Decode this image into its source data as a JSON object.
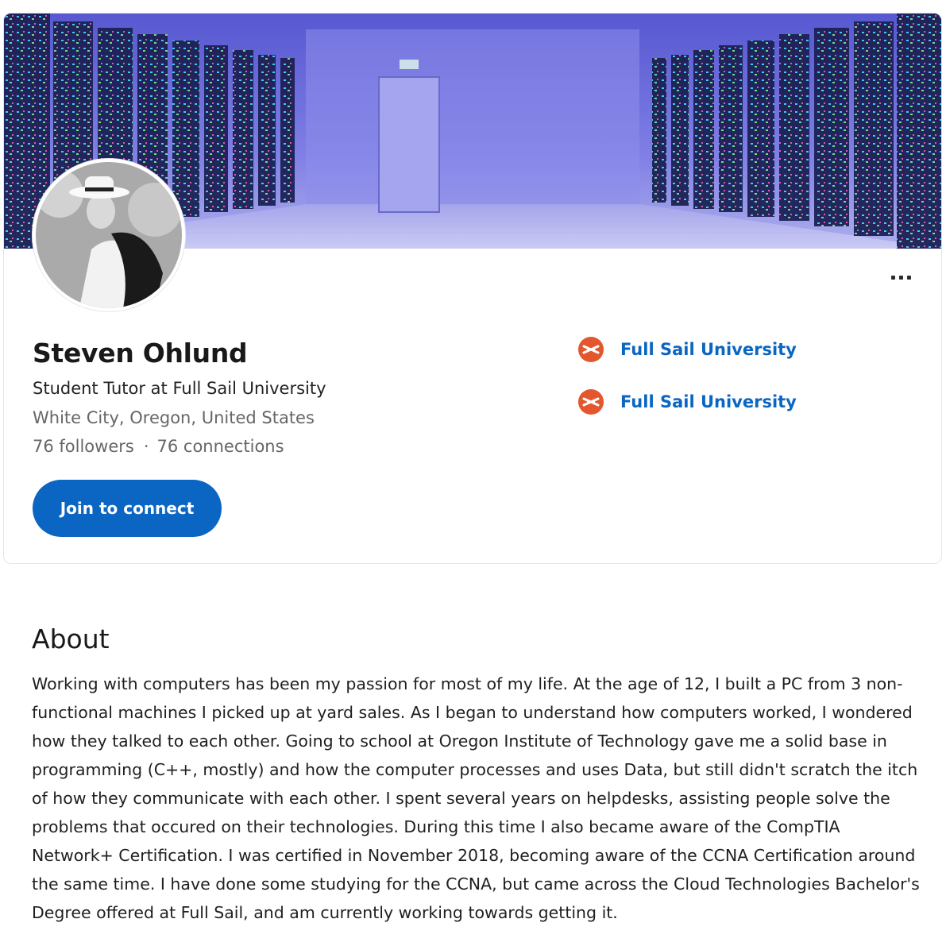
{
  "profile": {
    "name": "Steven Ohlund",
    "headline": "Student Tutor at Full Sail University",
    "location": "White City, Oregon, United States",
    "followers": "76 followers",
    "separator": "·",
    "connections": "76 connections",
    "join_label": "Join to connect",
    "more_label": "More actions"
  },
  "education": [
    {
      "name": "Full Sail University",
      "icon": "full-sail-logo-icon",
      "color": "#e4572e"
    },
    {
      "name": "Full Sail University",
      "icon": "full-sail-logo-icon",
      "color": "#e4572e"
    }
  ],
  "about": {
    "title": "About",
    "text": "Working with computers has been my passion for most of my life. At the age of 12, I built a PC from 3 non-functional machines I picked up at yard sales. As I began to understand how computers worked, I wondered how they talked to each other. Going to school at Oregon Institute of Technology gave me a solid base in programming (C++, mostly) and how the computer processes and uses Data, but still didn't scratch the itch of how they communicate with each other. I spent several years on helpdesks, assisting people solve the problems that occured on their technologies. During this time I also became aware of the CompTIA Network+ Certification. I was certified in November 2018, becoming aware of the CCNA Certification around the same time. I have done some studying for the CCNA, but came across the Cloud Technologies Bachelor's Degree offered at Full Sail, and am currently working towards getting it."
  },
  "colors": {
    "accent": "#0a66c2",
    "banner_tint": "#6f6fe0"
  }
}
